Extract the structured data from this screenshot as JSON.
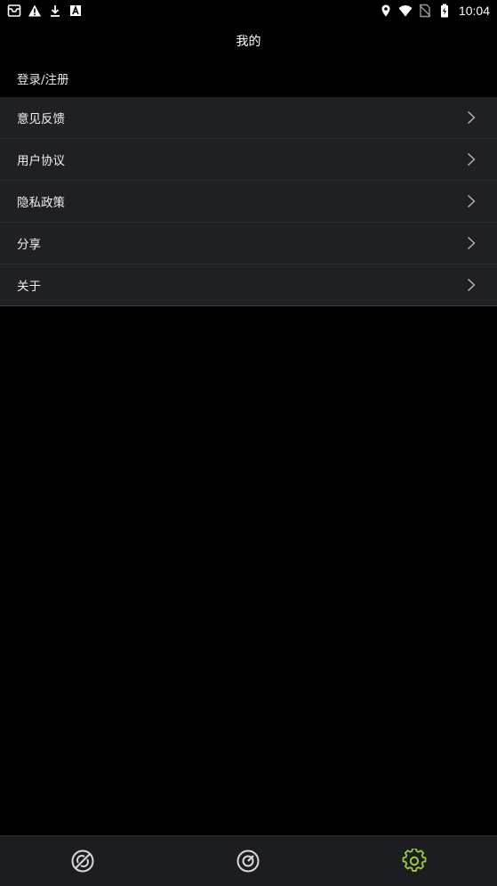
{
  "status_bar": {
    "time": "10:04",
    "left_icons": [
      "inbox-icon",
      "warning-icon",
      "download-icon",
      "a-badge-icon"
    ],
    "right_icons": [
      "location-icon",
      "wifi-icon",
      "no-sim-icon",
      "battery-icon"
    ]
  },
  "header": {
    "title": "我的"
  },
  "login": {
    "label": "登录/注册"
  },
  "menu": {
    "items": [
      {
        "label": "意见反馈",
        "icon": "chevron-right-icon"
      },
      {
        "label": "用户协议",
        "icon": "chevron-right-icon"
      },
      {
        "label": "隐私政策",
        "icon": "chevron-right-icon"
      },
      {
        "label": "分享",
        "icon": "chevron-right-icon"
      },
      {
        "label": "关于",
        "icon": "chevron-right-icon"
      }
    ]
  },
  "bottom_nav": {
    "tabs": [
      {
        "icon": "satellite-icon",
        "active": false
      },
      {
        "icon": "speedometer-icon",
        "active": false
      },
      {
        "icon": "settings-gear-icon",
        "active": true
      }
    ],
    "colors": {
      "inactive": "#d8d8d8",
      "active": "#9acd32"
    }
  },
  "colors": {
    "background": "#000000",
    "menu_row": "#1f2024",
    "nav_bar": "#1c1d21"
  }
}
